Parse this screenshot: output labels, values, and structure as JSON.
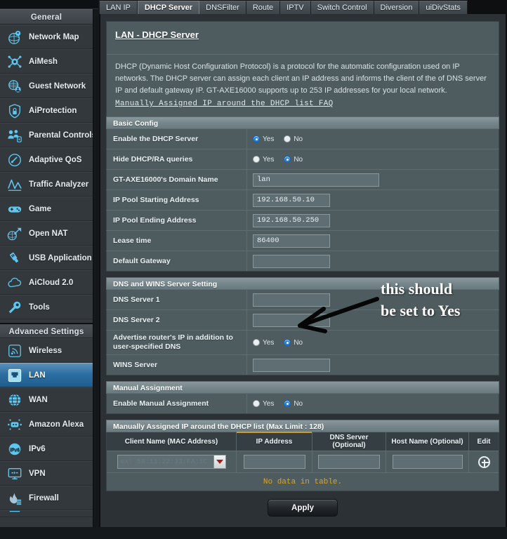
{
  "sidebar": {
    "group_general": "General",
    "group_advanced": "Advanced Settings",
    "general_items": [
      {
        "label": "Network Map",
        "icon": "network-map-icon"
      },
      {
        "label": "AiMesh",
        "icon": "aimesh-icon"
      },
      {
        "label": "Guest Network",
        "icon": "guest-network-icon"
      },
      {
        "label": "AiProtection",
        "icon": "shield-lock-icon"
      },
      {
        "label": "Parental Controls",
        "icon": "parental-controls-icon"
      },
      {
        "label": "Adaptive QoS",
        "icon": "gauge-icon"
      },
      {
        "label": "Traffic Analyzer",
        "icon": "traffic-analyzer-icon"
      },
      {
        "label": "Game",
        "icon": "gamepad-icon"
      },
      {
        "label": "Open NAT",
        "icon": "open-nat-icon"
      },
      {
        "label": "USB Application",
        "icon": "usb-icon"
      },
      {
        "label": "AiCloud 2.0",
        "icon": "cloud-icon"
      },
      {
        "label": "Tools",
        "icon": "wrench-icon"
      }
    ],
    "advanced_items": [
      {
        "label": "Wireless",
        "icon": "wireless-icon",
        "active": false
      },
      {
        "label": "LAN",
        "icon": "lan-port-icon",
        "active": true
      },
      {
        "label": "WAN",
        "icon": "globe-icon",
        "active": false
      },
      {
        "label": "Amazon Alexa",
        "icon": "alexa-icon",
        "active": false
      },
      {
        "label": "IPv6",
        "icon": "ipv6-globe-icon",
        "active": false
      },
      {
        "label": "VPN",
        "icon": "vpn-monitor-icon",
        "active": false
      },
      {
        "label": "Firewall",
        "icon": "firewall-flame-icon",
        "active": false
      }
    ]
  },
  "tabs": [
    {
      "label": "LAN IP",
      "active": false
    },
    {
      "label": "DHCP Server",
      "active": true
    },
    {
      "label": "DNSFilter",
      "active": false
    },
    {
      "label": "Route",
      "active": false
    },
    {
      "label": "IPTV",
      "active": false
    },
    {
      "label": "Switch Control",
      "active": false
    },
    {
      "label": "Diversion",
      "active": false
    },
    {
      "label": "uiDivStats",
      "active": false
    }
  ],
  "page": {
    "title": "LAN - DHCP Server",
    "description": "DHCP (Dynamic Host Configuration Protocol) is a protocol for the automatic configuration used on IP networks. The DHCP server can assign each client an IP address and informs the client of the of DNS server IP and default gateway IP. GT-AXE16000 supports up to 253 IP addresses for your local network.",
    "faq_link": "Manually Assigned IP around the DHCP list FAQ"
  },
  "basic_config": {
    "heading": "Basic Config",
    "rows": [
      {
        "label": "Enable the DHCP Server",
        "type": "radio",
        "yes": "Yes",
        "no": "No",
        "selected": "yes"
      },
      {
        "label": "Hide DHCP/RA queries",
        "type": "radio",
        "yes": "Yes",
        "no": "No",
        "selected": "no"
      },
      {
        "label": "GT-AXE16000's Domain Name",
        "type": "text",
        "value": "lan",
        "placeholder": ""
      },
      {
        "label": "IP Pool Starting Address",
        "type": "text",
        "value": "192.168.50.10",
        "placeholder": ""
      },
      {
        "label": "IP Pool Ending Address",
        "type": "text",
        "value": "192.168.50.250",
        "placeholder": ""
      },
      {
        "label": "Lease time",
        "type": "text",
        "value": "86400",
        "placeholder": ""
      },
      {
        "label": "Default Gateway",
        "type": "text",
        "value": "",
        "placeholder": ""
      }
    ]
  },
  "dns_wins": {
    "heading": "DNS and WINS Server Setting",
    "rows": [
      {
        "label": "DNS Server 1",
        "type": "text",
        "value": "",
        "placeholder": ""
      },
      {
        "label": "DNS Server 2",
        "type": "text",
        "value": "",
        "placeholder": ""
      },
      {
        "label": "Advertise router's IP in addition to user-specified DNS",
        "type": "radio",
        "yes": "Yes",
        "no": "No",
        "selected": "no"
      },
      {
        "label": "WINS Server",
        "type": "text",
        "value": "",
        "placeholder": ""
      }
    ]
  },
  "manual_assignment": {
    "heading": "Manual Assignment",
    "enable_label": "Enable Manual Assignment",
    "yes": "Yes",
    "no": "No",
    "selected": "no"
  },
  "manual_list": {
    "heading": "Manually Assigned IP around the DHCP list (Max Limit : 128)",
    "columns": [
      {
        "label": "Client Name (MAC Address)",
        "sorted": false
      },
      {
        "label": "IP Address",
        "sorted": true
      },
      {
        "label": "DNS Server (Optional)",
        "sorted": false
      },
      {
        "label": "Host Name (Optional)",
        "sorted": false
      },
      {
        "label": "Edit",
        "sorted": false
      }
    ],
    "input_row": {
      "mac_placeholder": "ex: 58:11:22:33:FA:1C",
      "mac_value": "",
      "ip_value": "",
      "dns_value": "",
      "host_value": "",
      "add_icon": "plus-circle-icon"
    },
    "empty_text": "No data in table."
  },
  "apply_button": "Apply",
  "annotation": {
    "line1": "this should",
    "line2": "be set to Yes",
    "arrow": "arrow-pointing-left-down-icon"
  },
  "colors": {
    "accent_blue": "#1f7fe0",
    "sidebar_bg": "#33383c",
    "panel_bg": "#4e5b5f",
    "section_head": "#76868b",
    "nodata_text": "#d9a62c",
    "icon_cyan": "#5fc7ef",
    "sort_marker": "#c99a3a"
  }
}
